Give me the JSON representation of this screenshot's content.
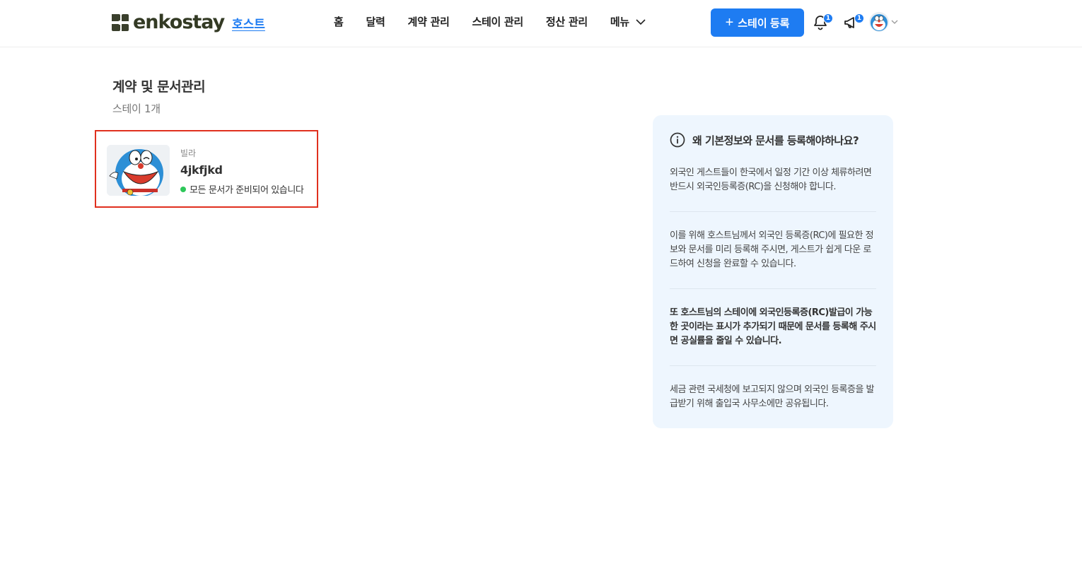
{
  "header": {
    "logo_text": "enkostay",
    "host_link": "호스트",
    "nav": [
      {
        "label": "홈"
      },
      {
        "label": "달력"
      },
      {
        "label": "계약 관리"
      },
      {
        "label": "스테이 관리"
      },
      {
        "label": "정산 관리"
      }
    ],
    "menu_label": "메뉴",
    "register_button": "스테이 등록",
    "notification_badge": "1",
    "announcement_badge": "1",
    "accent_color": "#1e7cf2"
  },
  "main": {
    "title": "계약 및 문서관리",
    "subtitle": "스테이 1개",
    "stays": [
      {
        "type": "빌라",
        "name": "4jkfjkd",
        "status": "모든 문서가 준비되어 있습니다",
        "status_color": "#2ec75a"
      }
    ]
  },
  "info": {
    "title": "왜 기본정보와 문서를 등록해야하나요?",
    "paragraphs": [
      {
        "text": "외국인 게스트들이 한국에서 일정 기간 이상 체류하려면 반드시 외국인등록증(RC)을 신청해야 합니다.",
        "bold": false
      },
      {
        "text": "이를 위해 호스트님께서 외국인 등록증(RC)에 필요한 정보와 문서를 미리 등록해 주시면, 게스트가 쉽게 다운 로드하여 신청을 완료할 수 있습니다.",
        "bold": false
      },
      {
        "text": "또 호스트님의 스테이에 외국인등록증(RC)발급이 가능한 곳이라는 표시가 추가되기 때문에 문서를 등록해 주시면 공실률을 줄일 수 있습니다.",
        "bold": true
      },
      {
        "text": "세금 관련 국세청에 보고되지 않으며 외국인 등록증을 발급받기 위해 출입국 사무소에만 공유됩니다.",
        "bold": false
      }
    ]
  },
  "icons": [
    "logo-icon",
    "chevron-down-icon",
    "plus-icon",
    "bell-icon",
    "megaphone-icon",
    "avatar-icon",
    "info-icon"
  ]
}
